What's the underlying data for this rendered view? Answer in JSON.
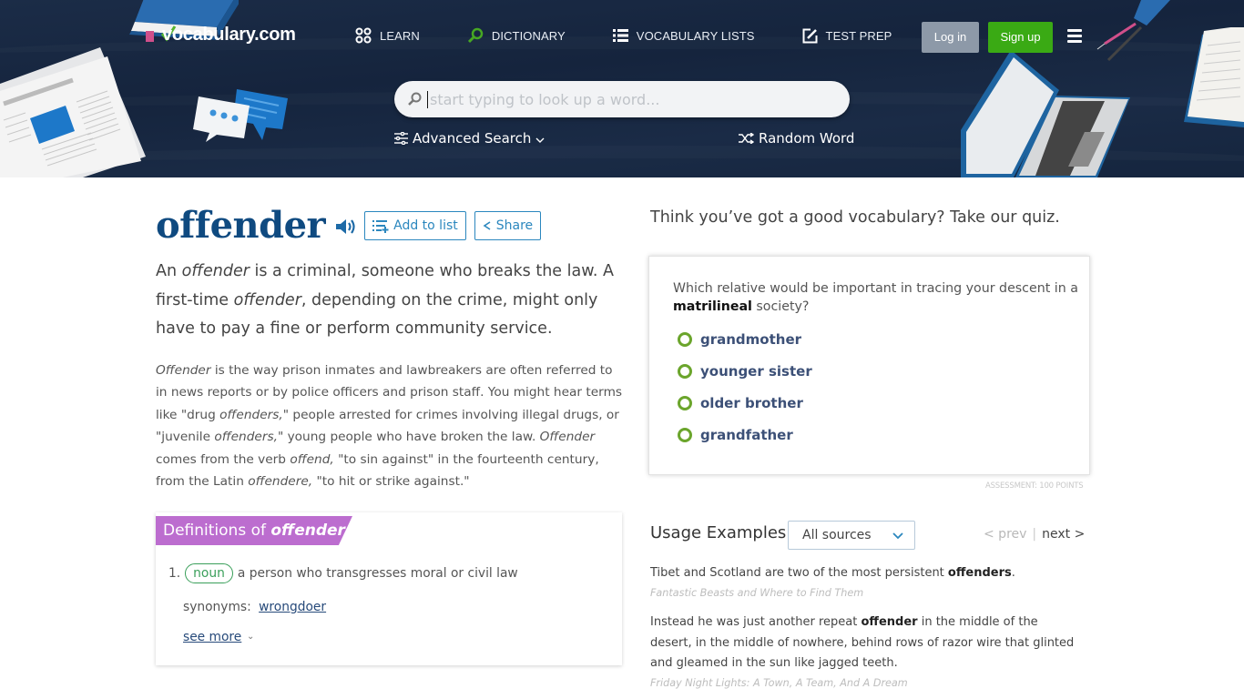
{
  "header": {
    "logo_text": "vocabulary.com",
    "nav": [
      {
        "label": "LEARN",
        "icon": "grid-circles-icon"
      },
      {
        "label": "DICTIONARY",
        "icon": "magnifier-icon"
      },
      {
        "label": "VOCABULARY LISTS",
        "icon": "list-icon"
      },
      {
        "label": "TEST PREP",
        "icon": "edit-icon"
      }
    ],
    "login_label": "Log in",
    "signup_label": "Sign up",
    "menu_icon": "hamburger-icon",
    "search": {
      "placeholder": "start typing to look up a word...",
      "value": ""
    },
    "advanced_search_label": "Advanced Search",
    "random_word_label": "Random Word",
    "colors": {
      "header_bg": "#172841",
      "signup": "#3aaa14",
      "login": "#8d99a8"
    }
  },
  "word": {
    "title": "offender",
    "speaker_icon": "speaker-icon",
    "add_to_list_label": "Add to list",
    "share_label": "Share",
    "short_desc": {
      "p1": "An ",
      "w1": "offender",
      "p2": " is a criminal, someone who breaks the law. A first-time ",
      "w2": "offender",
      "p3": ", depending on the crime, might only have to pay a fine or perform community service."
    },
    "long_desc": {
      "w1": "Offender",
      "p1": " is the way prison inmates and lawbreakers are often referred to in news reports or by police officers and prison staff. You might hear terms like \"drug ",
      "w2": "offenders,",
      "p2": "\" people arrested for crimes involving illegal drugs, or \"juvenile ",
      "w3": "offenders,",
      "p3": "\" young people who have broken the law. ",
      "w4": "Offender",
      "p4": " comes from the verb ",
      "w5": "offend,",
      "p5": " \"to sin against\" in the fourteenth century, from the Latin ",
      "w6": "offendere,",
      "p6": " \"to hit or strike against.\""
    }
  },
  "definitions": {
    "banner_prefix": "Definitions of ",
    "banner_word": "offender",
    "items": [
      {
        "num": "1.",
        "pos": "noun",
        "text": "a person who transgresses moral or civil law",
        "synonyms_label": "synonyms:",
        "synonym": "wrongdoer"
      }
    ],
    "see_more_label": "see more",
    "banner_color": "#bc6dcf"
  },
  "quiz": {
    "heading": "Think you’ve got a good vocabulary? Take our quiz.",
    "question_pre": "Which relative would be important in tracing your descent in a ",
    "question_word": "matrilineal",
    "question_post": " society?",
    "options": [
      "grandmother",
      "younger sister",
      "older brother",
      "grandfather"
    ],
    "assessment": "ASSESSMENT: 100 POINTS"
  },
  "usage": {
    "title": "Usage Examples",
    "source_select": "All sources",
    "prev_label": "< prev",
    "separator": "|",
    "next_label": "next >",
    "examples": [
      {
        "pre": "Tibet and Scotland are two of the most persistent ",
        "word": "offenders",
        "post": ".",
        "source": "Fantastic Beasts and Where to Find Them"
      },
      {
        "pre": "Instead he was just another repeat ",
        "word": "offender",
        "post": " in the middle of the desert, in the middle of nowhere, behind rows of razor wire that glinted and gleamed in the sun like jagged teeth.",
        "source": "Friday Night Lights: A Town, A Team, And A Dream"
      }
    ]
  }
}
